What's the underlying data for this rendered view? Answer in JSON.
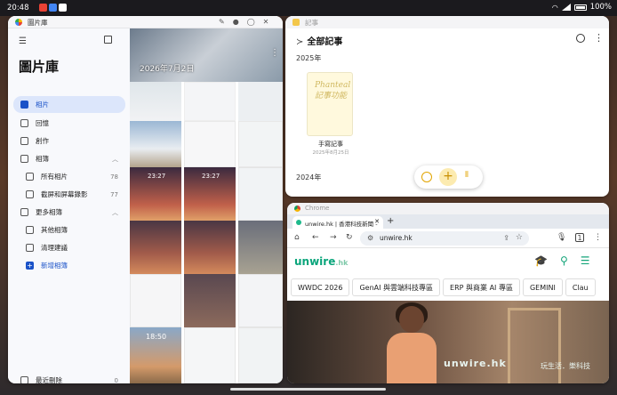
{
  "status_bar": {
    "time": "20:48",
    "app_icon_colors": [
      "#e94235",
      "#4285f4",
      "#ffffff"
    ],
    "battery": "100%"
  },
  "gallery": {
    "window_title": "圖片庫",
    "heading": "圖片庫",
    "date_header": "2026年7月2日",
    "nav": {
      "photos": "相片",
      "memories": "回憶",
      "create": "創作",
      "albums": "相簿",
      "all_photos": "所有相片",
      "all_photos_count": "78",
      "screenshots": "截屏和屏幕錄影",
      "screenshots_count": "77",
      "more_albums": "更多相簿",
      "other_albums": "其他相簿",
      "cleanup": "清理建議",
      "new_album": "新增相簿",
      "recently_deleted": "最近刪除",
      "recently_deleted_count": "0"
    },
    "accent_color": "#1a52c8",
    "thumb_clock_1": "23:27",
    "thumb_clock_2": "23:27",
    "thumb_clock_3": "18:50"
  },
  "notes": {
    "window_title": "記事",
    "heading": "全部記事",
    "year_1": "2025年",
    "card_scribble": "Phanteal 記事功能",
    "card_title": "手寫記事",
    "card_date": "2025年8月25日",
    "year_2": "2024年",
    "accent_color": "#e2a500"
  },
  "chrome": {
    "window_title": "Chrome",
    "tab_title": "unwire.hk | 香港科技新聞 -",
    "url": "unwire.hk",
    "site_logo": "unwire",
    "site_logo_suffix": ".hk",
    "tags": [
      "WWDC 2026",
      "GenAI 與雲端科技專區",
      "ERP 與商業 AI 專區",
      "GEMINI",
      "Clau"
    ],
    "watermark": "unwire.hk",
    "watermark_tagline": "玩生活．樂科技",
    "brand_color": "#0aa57b"
  }
}
